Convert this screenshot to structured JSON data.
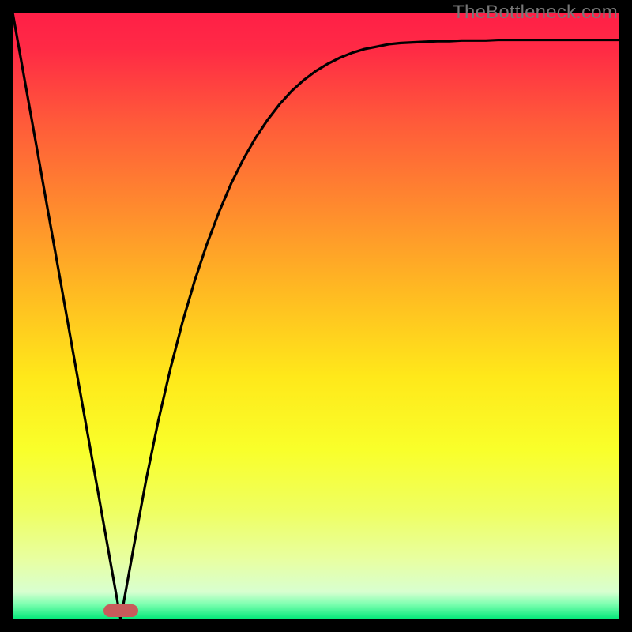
{
  "watermark": "TheBottleneck.com",
  "gradient": {
    "stops": [
      {
        "offset": 0.0,
        "color": "#ff1f47"
      },
      {
        "offset": 0.06,
        "color": "#ff2a45"
      },
      {
        "offset": 0.18,
        "color": "#ff5a3a"
      },
      {
        "offset": 0.32,
        "color": "#ff8a2e"
      },
      {
        "offset": 0.46,
        "color": "#ffba22"
      },
      {
        "offset": 0.6,
        "color": "#ffe81a"
      },
      {
        "offset": 0.72,
        "color": "#f9ff2a"
      },
      {
        "offset": 0.82,
        "color": "#efff60"
      },
      {
        "offset": 0.9,
        "color": "#e8ffa0"
      },
      {
        "offset": 0.955,
        "color": "#d8ffd0"
      },
      {
        "offset": 0.975,
        "color": "#7dffb0"
      },
      {
        "offset": 1.0,
        "color": "#00e878"
      }
    ]
  },
  "marker": {
    "x_frac": 0.178,
    "y_frac": 0.986,
    "color": "#c85b5b"
  },
  "chart_data": {
    "type": "line",
    "title": "",
    "xlabel": "",
    "ylabel": "",
    "xlim": [
      0,
      1
    ],
    "ylim": [
      0,
      1
    ],
    "grid": false,
    "legend": false,
    "series": [
      {
        "name": "curve",
        "x": [
          0.0,
          0.02,
          0.04,
          0.06,
          0.08,
          0.1,
          0.12,
          0.14,
          0.16,
          0.178,
          0.2,
          0.22,
          0.24,
          0.26,
          0.28,
          0.3,
          0.32,
          0.34,
          0.36,
          0.38,
          0.4,
          0.42,
          0.44,
          0.46,
          0.48,
          0.5,
          0.52,
          0.54,
          0.56,
          0.58,
          0.6,
          0.62,
          0.64,
          0.66,
          0.68,
          0.7,
          0.72,
          0.74,
          0.76,
          0.78,
          0.8,
          0.82,
          0.84,
          0.86,
          0.88,
          0.9,
          0.92,
          0.94,
          0.96,
          0.98,
          1.0
        ],
        "y": [
          1.0,
          0.888,
          0.776,
          0.663,
          0.551,
          0.438,
          0.326,
          0.214,
          0.101,
          0.0,
          0.122,
          0.23,
          0.327,
          0.413,
          0.49,
          0.558,
          0.618,
          0.671,
          0.718,
          0.758,
          0.793,
          0.823,
          0.849,
          0.871,
          0.889,
          0.904,
          0.916,
          0.926,
          0.934,
          0.94,
          0.944,
          0.948,
          0.95,
          0.951,
          0.952,
          0.953,
          0.953,
          0.954,
          0.954,
          0.954,
          0.955,
          0.955,
          0.955,
          0.955,
          0.955,
          0.955,
          0.955,
          0.955,
          0.955,
          0.955,
          0.955
        ]
      }
    ]
  }
}
